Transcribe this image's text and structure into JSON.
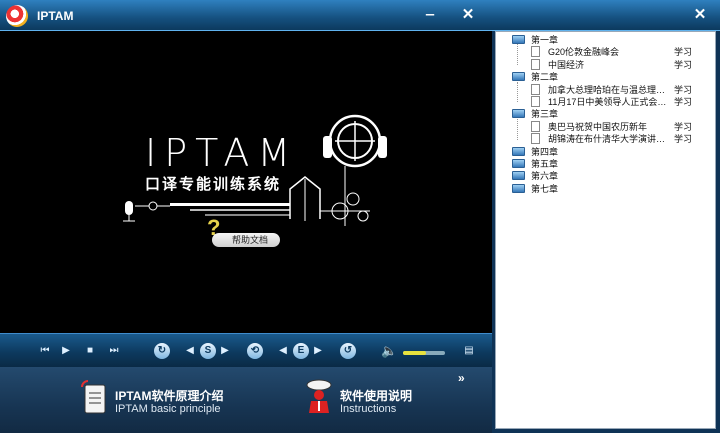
{
  "window": {
    "title": "IPTAM",
    "minimize_glyph": "‒",
    "close_glyph": "✕"
  },
  "splash": {
    "logo_text": "IPTAM",
    "subtitle": "口译专能训练系统",
    "help_label": "帮助文档",
    "help_glyph": "?"
  },
  "controls": {
    "prev_glyph": "⏮",
    "play_glyph": "▶",
    "stop_glyph": "■",
    "next_glyph": "⏭",
    "s_label": "S",
    "e_label": "E",
    "left_arrow": "◀",
    "right_arrow": "▶",
    "volume_level": 0.55,
    "volume_glyph": "🔈",
    "file_glyph": "▤"
  },
  "features": [
    {
      "title": "IPTAM软件原理介绍",
      "subtitle": "IPTAM basic principle",
      "icon": "document-icon"
    },
    {
      "title": "软件使用说明",
      "subtitle": "Instructions",
      "icon": "speaker-person-icon"
    }
  ],
  "expand_glyph": "»",
  "side": {
    "close_glyph": "✕",
    "chapters": [
      {
        "label": "第一章",
        "lessons": [
          {
            "title": "G20伦敦金融峰会",
            "action": "学习"
          },
          {
            "title": "中国经济",
            "action": "学习"
          }
        ]
      },
      {
        "label": "第二章",
        "lessons": [
          {
            "title": "加拿大总理哈珀在与温总理…",
            "action": "学习"
          },
          {
            "title": "11月17日中美领导人正式会…",
            "action": "学习"
          }
        ]
      },
      {
        "label": "第三章",
        "lessons": [
          {
            "title": "奥巴马祝贺中国农历新年",
            "action": "学习"
          },
          {
            "title": "胡锦涛在布什清华大学演讲…",
            "action": "学习"
          }
        ]
      },
      {
        "label": "第四章",
        "lessons": []
      },
      {
        "label": "第五章",
        "lessons": []
      },
      {
        "label": "第六章",
        "lessons": []
      },
      {
        "label": "第七章",
        "lessons": []
      }
    ]
  },
  "colors": {
    "accent": "#2f80bf",
    "highlight": "#e8e23e"
  }
}
